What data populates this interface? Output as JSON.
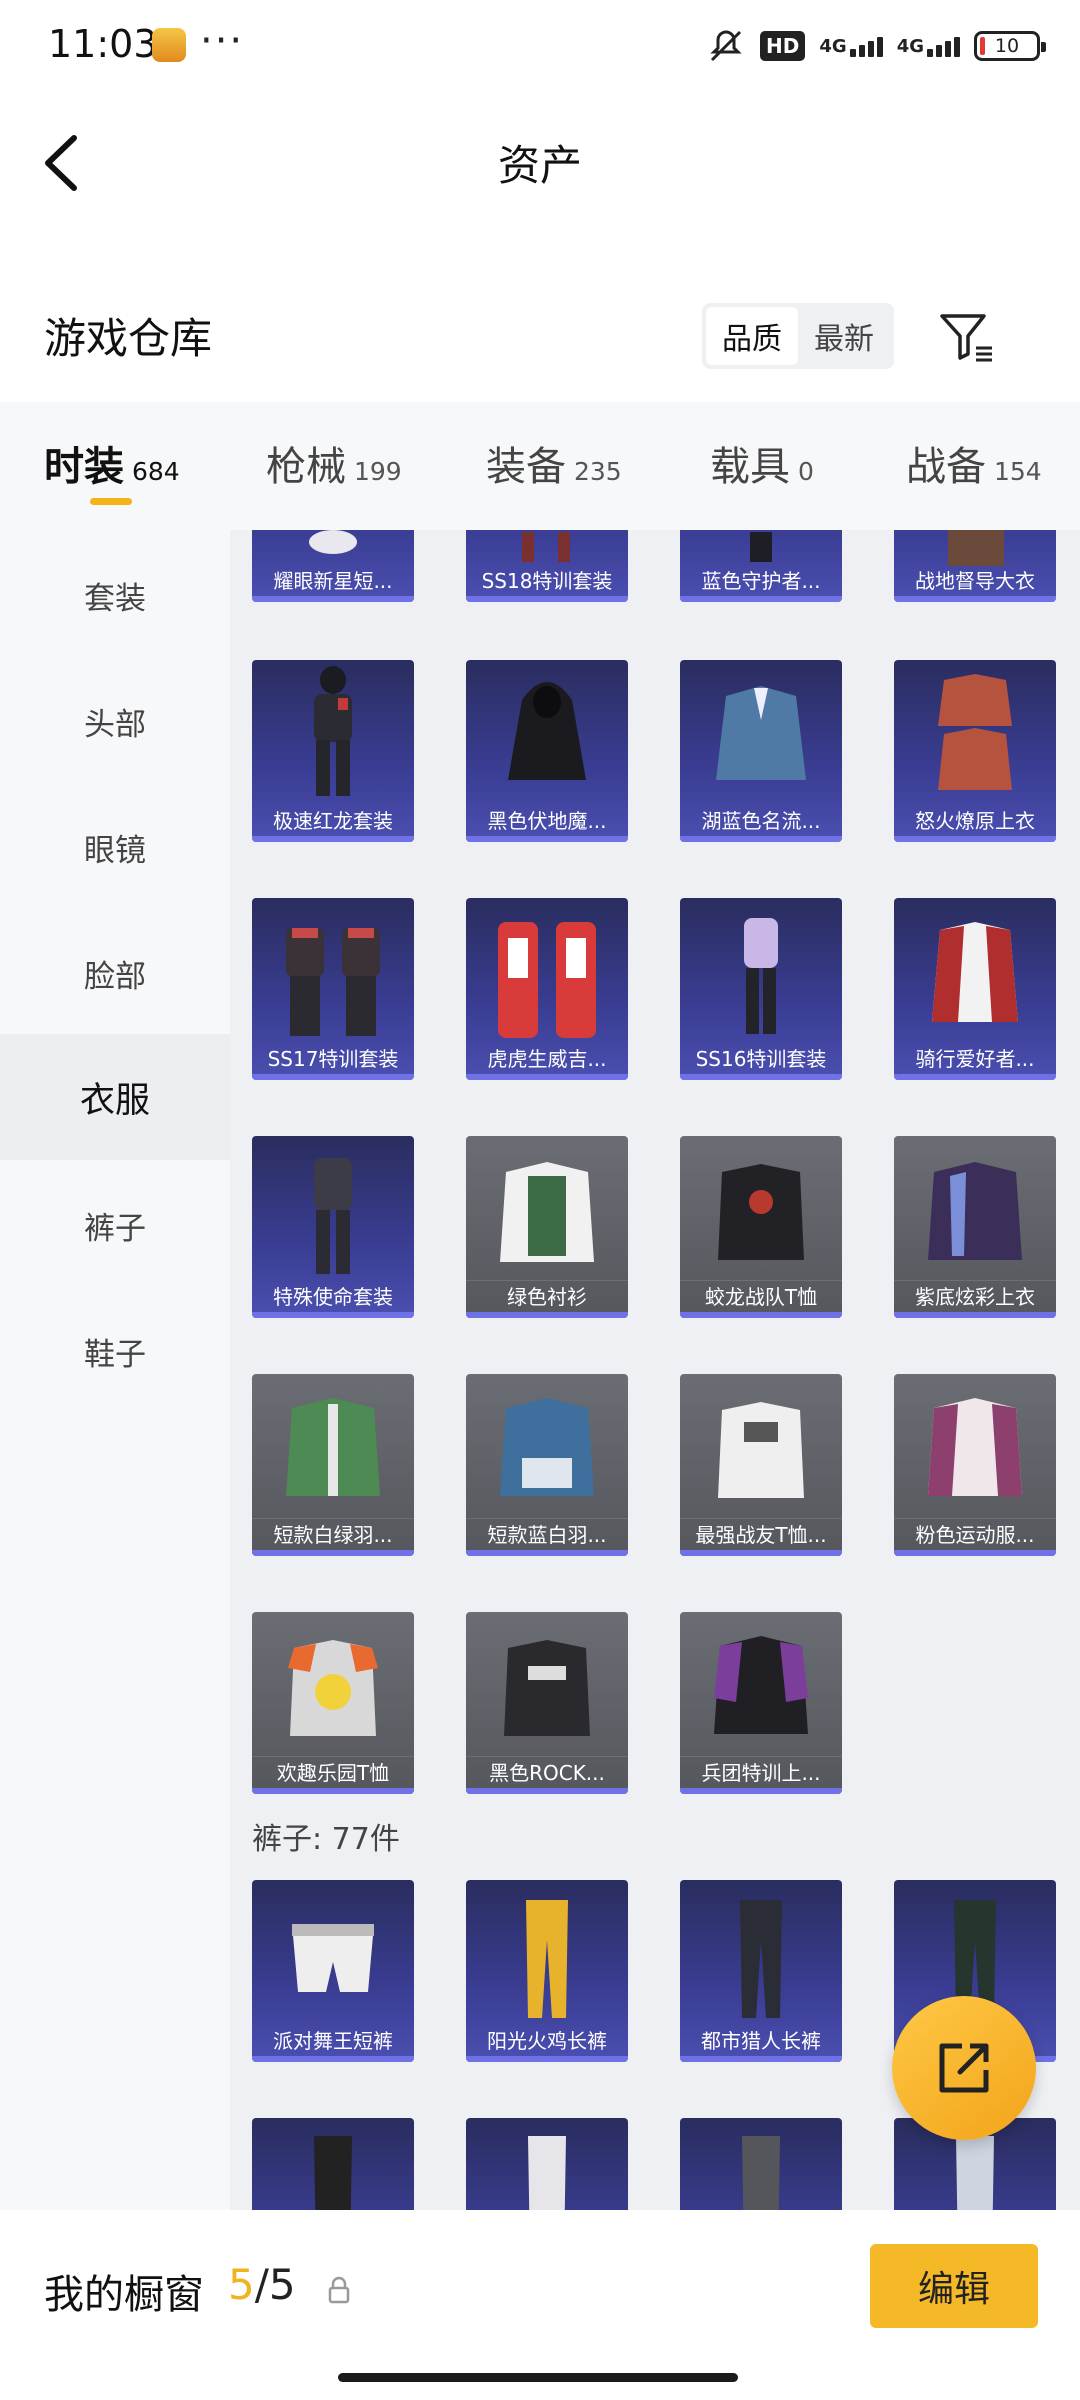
{
  "status_bar": {
    "time": "11:03",
    "dots": "···",
    "hd": "HD",
    "net1": "4G",
    "net2": "4G",
    "battery": "10"
  },
  "header": {
    "title": "资产"
  },
  "warehouse": {
    "title": "游戏仓库",
    "sort_options": [
      "品质",
      "最新"
    ],
    "active_sort": "品质"
  },
  "category_tabs": [
    {
      "name": "时装",
      "count": "684",
      "active": true
    },
    {
      "name": "枪械",
      "count": "199"
    },
    {
      "name": "装备",
      "count": "235"
    },
    {
      "name": "载具",
      "count": "0"
    },
    {
      "name": "战备",
      "count": "154"
    }
  ],
  "sidebar": [
    "套装",
    "头部",
    "眼镜",
    "脸部",
    "衣服",
    "裤子",
    "鞋子"
  ],
  "sidebar_active": "衣服",
  "items_clothes_top": [
    "耀眼新星短...",
    "SS18特训套装",
    "蓝色守护者...",
    "战地督导大衣"
  ],
  "items_clothes": [
    {
      "label": "极速红龙套装",
      "tier": "purple"
    },
    {
      "label": "黑色伏地魔...",
      "tier": "purple"
    },
    {
      "label": "湖蓝色名流...",
      "tier": "purple"
    },
    {
      "label": "怒火燎原上衣",
      "tier": "purple"
    },
    {
      "label": "SS17特训套装",
      "tier": "purple"
    },
    {
      "label": "虎虎生威吉...",
      "tier": "purple"
    },
    {
      "label": "SS16特训套装",
      "tier": "purple"
    },
    {
      "label": "骑行爱好者...",
      "tier": "purple"
    },
    {
      "label": "特殊使命套装",
      "tier": "purple"
    },
    {
      "label": "绿色衬衫",
      "tier": "gray"
    },
    {
      "label": "蛟龙战队T恤",
      "tier": "gray"
    },
    {
      "label": "紫底炫彩上衣",
      "tier": "gray"
    },
    {
      "label": "短款白绿羽...",
      "tier": "gray"
    },
    {
      "label": "短款蓝白羽...",
      "tier": "gray"
    },
    {
      "label": "最强战友T恤...",
      "tier": "gray"
    },
    {
      "label": "粉色运动服...",
      "tier": "gray"
    },
    {
      "label": "欢趣乐园T恤",
      "tier": "gray"
    },
    {
      "label": "黑色ROCK...",
      "tier": "gray"
    },
    {
      "label": "兵团特训上...",
      "tier": "gray"
    }
  ],
  "pants_section": {
    "title": "裤子: 77件"
  },
  "items_pants": [
    "派对舞王短裤",
    "阳光火鸡长裤",
    "都市猎人长裤",
    ""
  ],
  "bottom_bar": {
    "title": "我的橱窗",
    "current": "5",
    "separator": "/",
    "total": "5",
    "edit_label": "编辑"
  },
  "colors": {
    "accent": "#f5b927",
    "purple_tier": "#3a3d93",
    "gray_tier": "#5f6167"
  }
}
